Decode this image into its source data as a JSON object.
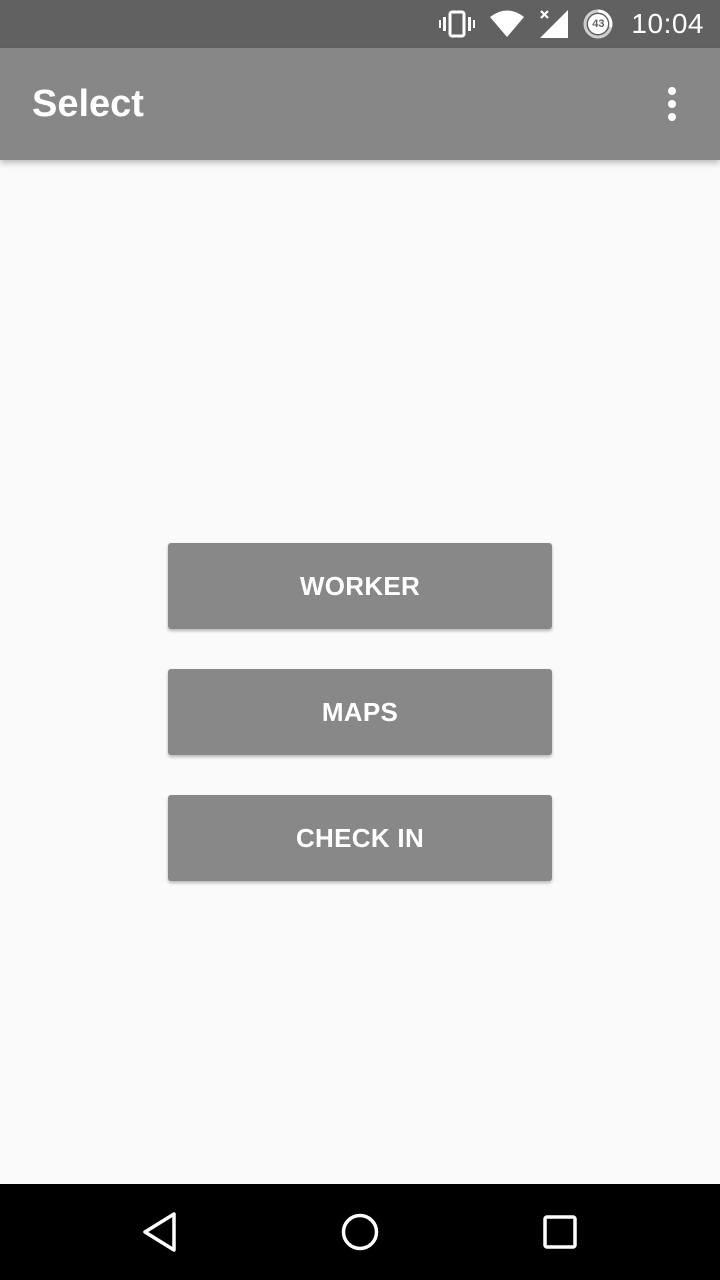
{
  "status_bar": {
    "time": "10:04",
    "battery_level": "43",
    "icons": [
      "vibrate-icon",
      "wifi-icon",
      "cell-signal-icon",
      "battery-saver-icon"
    ]
  },
  "app_bar": {
    "title": "Select",
    "overflow_icon": "more-vert-icon"
  },
  "buttons": {
    "worker": "WORKER",
    "maps": "MAPS",
    "check_in": "CHECK IN"
  },
  "nav_bar": {
    "icons": [
      "back-icon",
      "home-icon",
      "recents-icon"
    ]
  },
  "colors": {
    "status_bar": "#616161",
    "app_bar": "#878787",
    "button": "#888888",
    "background": "#fafafa",
    "nav_bar": "#000000"
  }
}
